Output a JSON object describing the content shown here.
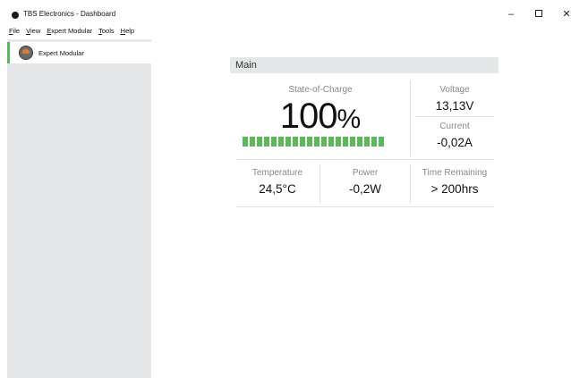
{
  "window": {
    "title": "TBS Electronics - Dashboard",
    "minimize_glyph": "–",
    "close_glyph": "✕"
  },
  "menu": {
    "items": [
      {
        "accel": "F",
        "rest": "ile"
      },
      {
        "accel": "V",
        "rest": "iew"
      },
      {
        "accel": "E",
        "rest": "xpert Modular"
      },
      {
        "accel": "T",
        "rest": "ools"
      },
      {
        "accel": "H",
        "rest": "elp"
      }
    ]
  },
  "sidebar": {
    "items": [
      {
        "label": "Expert Modular",
        "icon": "battery-monitor-icon",
        "selected": true
      }
    ]
  },
  "colors": {
    "accent_green": "#5cb85c",
    "sidebar_bg": "#e6e7e8"
  },
  "main": {
    "panel_title": "Main",
    "soc": {
      "label": "State-of-Charge",
      "value": "100",
      "unit": "%",
      "level_fraction": 1.0
    },
    "voltage": {
      "label": "Voltage",
      "value": "13,13V"
    },
    "current": {
      "label": "Current",
      "value": "-0,02A"
    },
    "temperature": {
      "label": "Temperature",
      "value": "24,5°C"
    },
    "power": {
      "label": "Power",
      "value": "-0,2W"
    },
    "time_remaining": {
      "label": "Time Remaining",
      "value": "> 200hrs"
    }
  }
}
